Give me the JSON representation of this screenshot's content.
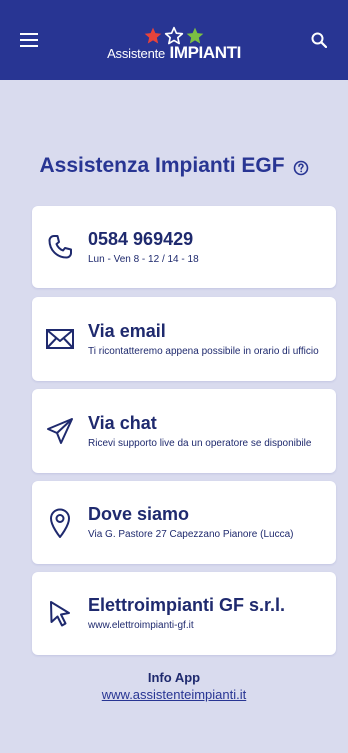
{
  "header": {
    "logo_line1": "Assistente",
    "logo_line2": "IMPIANTI",
    "star_colors": [
      "#e8433a",
      "#ffffff",
      "#7bc043"
    ]
  },
  "page": {
    "title": "Assistenza Impianti EGF"
  },
  "contacts": [
    {
      "icon": "phone-icon",
      "title": "0584 969429",
      "subtitle": "Lun - Ven 8 - 12 / 14 - 18"
    },
    {
      "icon": "envelope-icon",
      "title": "Via email",
      "subtitle": "Ti ricontatteremo appena possibile in orario di ufficio"
    },
    {
      "icon": "send-icon",
      "title": "Via chat",
      "subtitle": "Ricevi supporto live da un operatore se disponibile"
    },
    {
      "icon": "location-pin-icon",
      "title": "Dove siamo",
      "subtitle": "Via G. Pastore 27 Capezzano Pianore (Lucca)"
    },
    {
      "icon": "cursor-pointer-icon",
      "title": "Elettroimpianti GF s.r.l.",
      "subtitle": "www.elettroimpianti-gf.it"
    }
  ],
  "footer": {
    "label": "Info App",
    "link": "www.assistenteimpianti.it"
  },
  "colors": {
    "primary": "#283593",
    "background": "#d9dbee",
    "card": "#ffffff"
  }
}
